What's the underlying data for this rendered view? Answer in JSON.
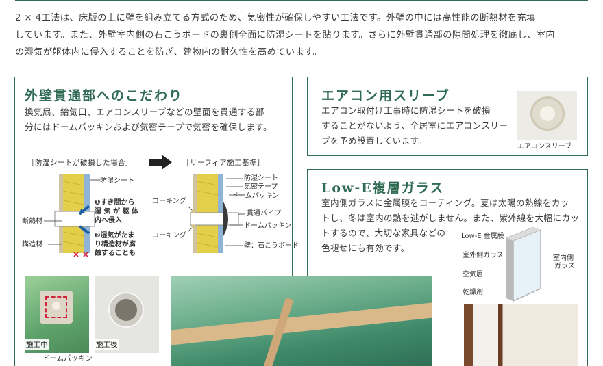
{
  "intro": {
    "line1": "2 × 4工法は、床版の上に壁を組み立てる方式のため、気密性が確保しやすい工法です。外壁の中には高性能の断熱材を充填",
    "line2": "しています。また、外壁室内側の石こうボードの裏側全面に防湿シートを貼ります。さらに外壁貫通部の隙間処理を徹底し、室内",
    "line3": "の湿気が躯体内に侵入することを防ぎ、建物内の耐久性を高めています。"
  },
  "penetration": {
    "title": "外壁貫通部へのこだわり",
    "body1": "換気扇、給気口、エアコンスリーブなどの壁面を貫通する部",
    "body2": "分にはドームパッキンおよび気密テープで気密を確保します。",
    "label_bad": "［防湿シートが破損した場合］",
    "label_good": "［リーフィア施工基準］",
    "bad": {
      "sheet": "防湿シート",
      "note1_a": "❶すき間から",
      "note1_b": "湿 気 が 躯 体",
      "note1_c": "内へ侵入",
      "note2_a": "❷湿気がたま",
      "note2_b": "り構造材が腐",
      "note2_c": "蝕することも",
      "insulation": "断熱材",
      "structure": "構造材"
    },
    "good": {
      "caulk1": "コーキング",
      "caulk2": "コーキング",
      "sheet": "防湿シート",
      "tape": "気密テープ",
      "packing1": "ドームパッキン",
      "pipe": "貫通パイプ",
      "packing2": "ドームパッキン",
      "board": "壁：石こうボード"
    },
    "photo_during": "施工中",
    "photo_after": "施工後",
    "photo_packing": "ドームパッキン"
  },
  "sleeve": {
    "title": "エアコン用スリーブ",
    "body1": "エアコン取付け工事時に防湿シートを破損",
    "body2": "することがないよう、全居室にエアコンスリー",
    "body3": "ブを予め設置しています。",
    "caption": "エアコンスリーブ"
  },
  "glass": {
    "title": "Low-E複層ガラス",
    "body1": "室内側ガラスに金属膜をコーティング。夏は太陽の熱線をカッ",
    "body2": "トし、冬は室内の熱を逃がしません。また、紫外線を大幅にカッ",
    "body3": "トするので、大切な家具などの",
    "body4": "色褪せにも有効です。",
    "labels": {
      "film": "Low-E 金属膜",
      "outer": "室外側ガラス",
      "air": "空気層",
      "dry": "乾燥剤",
      "inner1": "室内側",
      "inner2": "ガラス"
    }
  },
  "colors": {
    "accent": "#2f6b54",
    "insulation": "#e4cf4a",
    "sheet_blue": "#1e5fa8",
    "warning_red": "#d0253a"
  }
}
